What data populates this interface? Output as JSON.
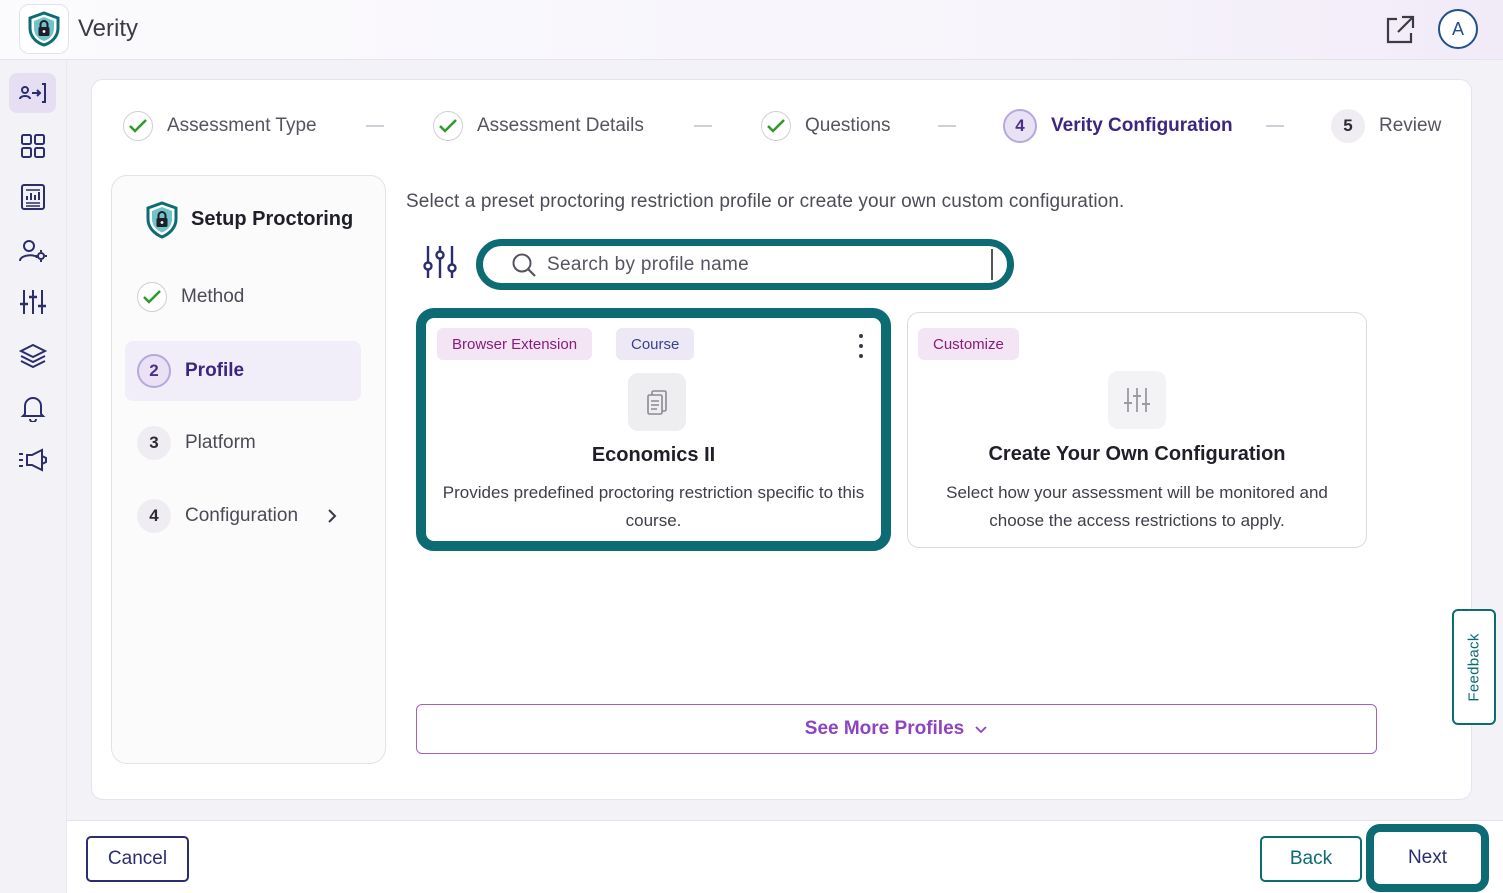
{
  "app": {
    "title": "Verity",
    "avatar_initial": "A"
  },
  "colors": {
    "accent_teal": "#0d6b73",
    "brand_purple": "#3e2680",
    "badge_purple": "#8a1c7c"
  },
  "rail": {
    "items": [
      {
        "name": "assign-icon",
        "active": true
      },
      {
        "name": "grid-icon",
        "active": false
      },
      {
        "name": "report-icon",
        "active": false
      },
      {
        "name": "user-settings-icon",
        "active": false
      },
      {
        "name": "sliders-icon",
        "active": false
      },
      {
        "name": "layers-icon",
        "active": false
      },
      {
        "name": "bell-icon",
        "active": false
      },
      {
        "name": "megaphone-icon",
        "active": false
      }
    ]
  },
  "stepper": {
    "steps": [
      {
        "label": "Assessment Type",
        "state": "done"
      },
      {
        "label": "Assessment Details",
        "state": "done"
      },
      {
        "label": "Questions",
        "state": "done"
      },
      {
        "number": "4",
        "label": "Verity Configuration",
        "state": "active"
      },
      {
        "number": "5",
        "label": "Review",
        "state": "pending"
      }
    ]
  },
  "side_panel": {
    "title": "Setup Proctoring",
    "items": [
      {
        "label": "Method",
        "state": "done"
      },
      {
        "number": "2",
        "label": "Profile",
        "state": "active"
      },
      {
        "number": "3",
        "label": "Platform",
        "state": "pending"
      },
      {
        "number": "4",
        "label": "Configuration",
        "state": "pending"
      }
    ]
  },
  "content": {
    "instruction": "Select a preset proctoring restriction profile or create your own custom configuration.",
    "search": {
      "placeholder": "Search by profile name",
      "value": ""
    },
    "profile_card": {
      "badges": [
        "Browser Extension",
        "Course"
      ],
      "title": "Economics II",
      "description": "Provides predefined proctoring restriction specific to this course."
    },
    "custom_card": {
      "badge": "Customize",
      "title": "Create Your Own Configuration",
      "description": "Select how your assessment will be monitored and choose the access restrictions to apply."
    },
    "see_more_label": "See More Profiles"
  },
  "feedback_label": "Feedback",
  "footer": {
    "cancel_label": "Cancel",
    "back_label": "Back",
    "next_label": "Next"
  }
}
